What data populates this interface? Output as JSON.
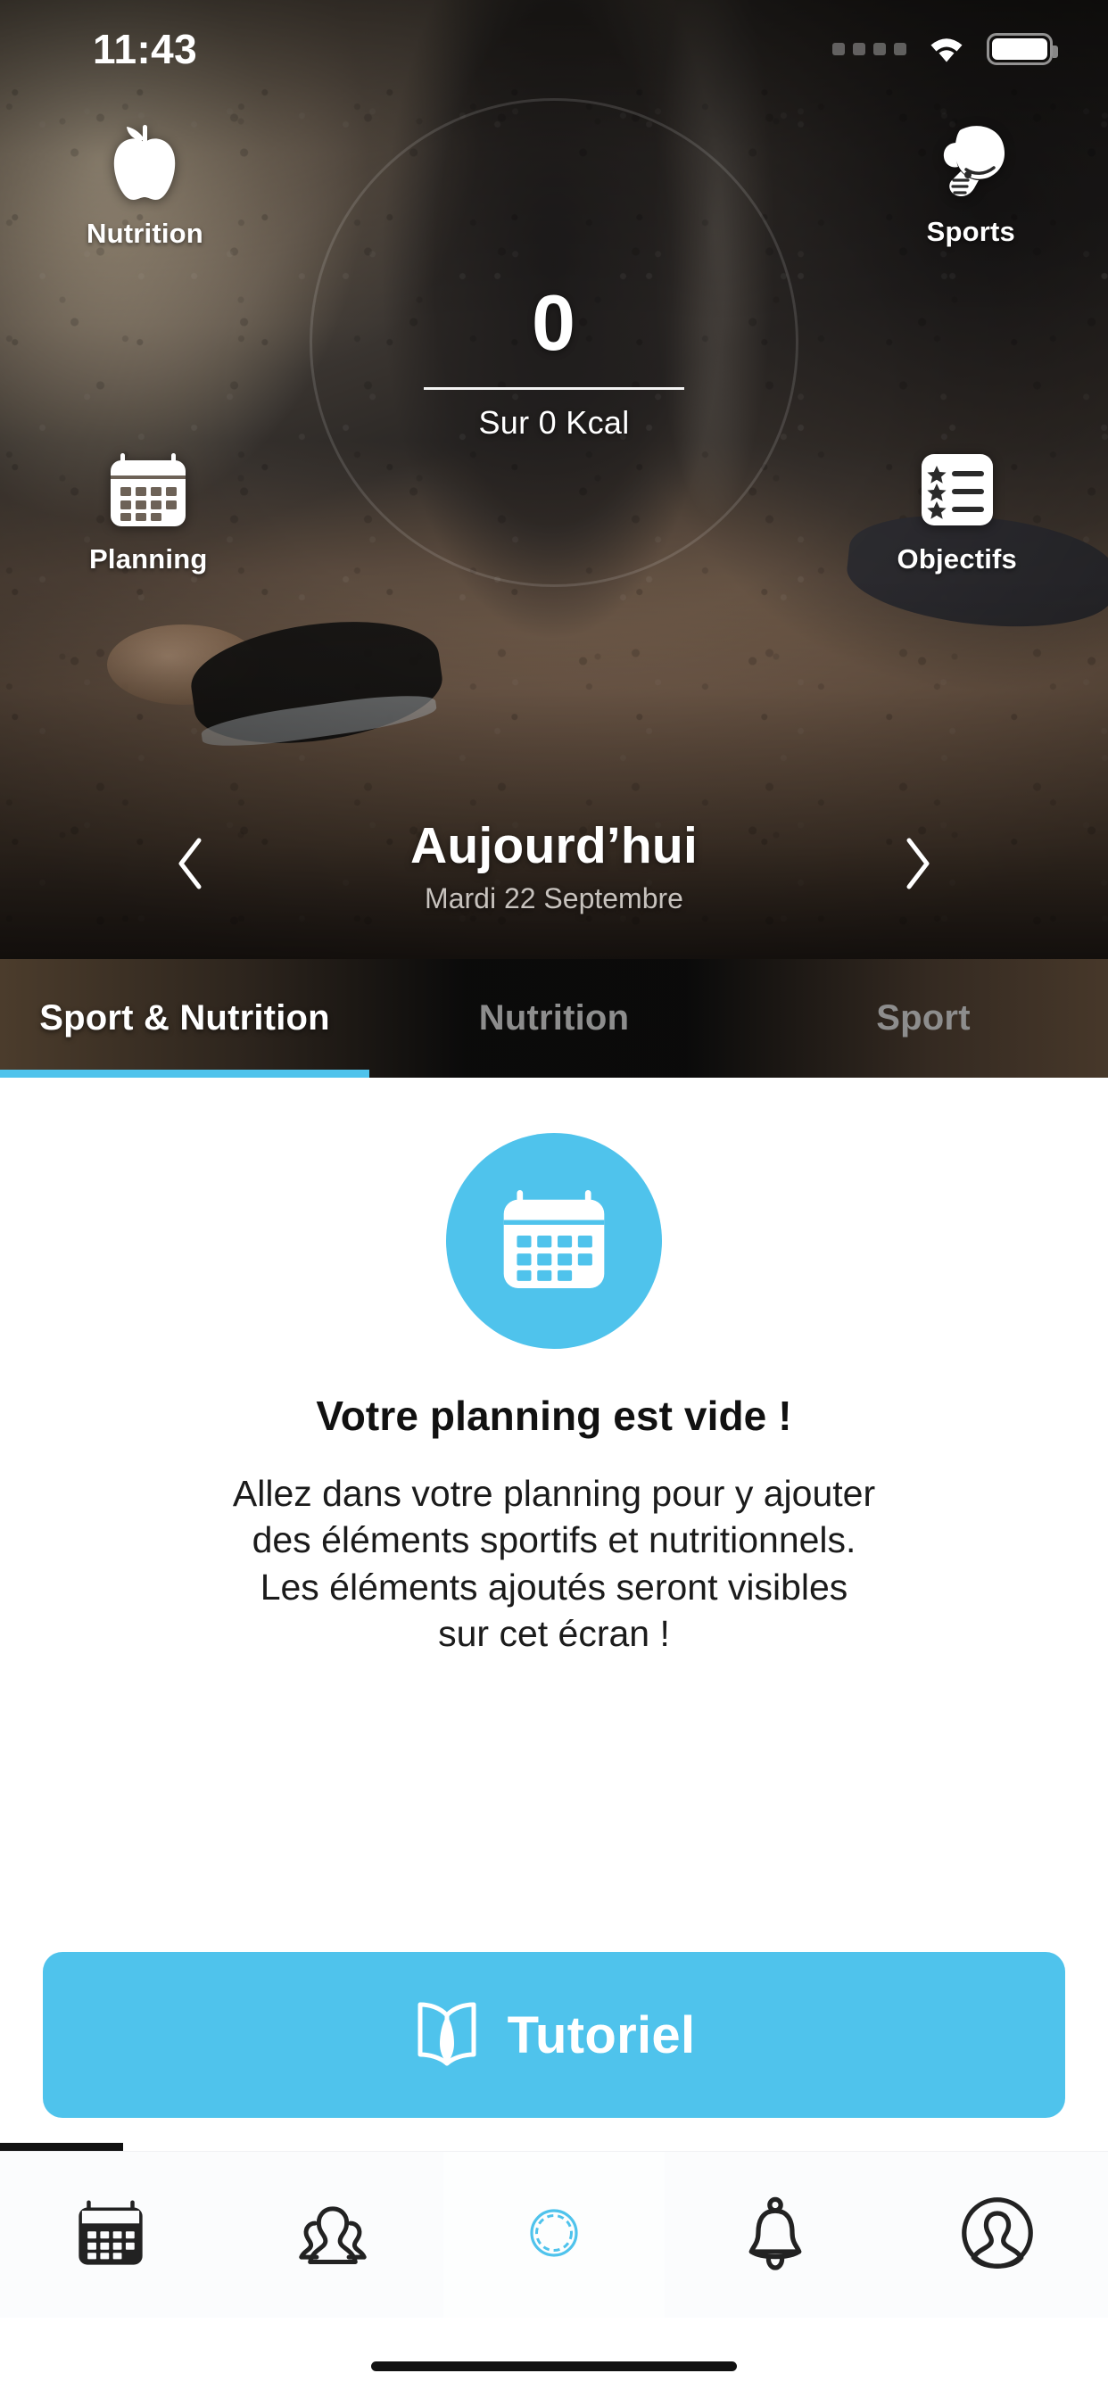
{
  "status_bar": {
    "time": "11:43",
    "signal_icon": "signal-dots-icon",
    "wifi_icon": "wifi-icon",
    "battery_icon": "battery-full-icon"
  },
  "hero": {
    "tiles": [
      {
        "id": "nutrition",
        "label": "Nutrition",
        "icon": "apple-icon"
      },
      {
        "id": "sports",
        "label": "Sports",
        "icon": "boxing-glove-icon"
      },
      {
        "id": "planning",
        "label": "Planning",
        "icon": "calendar-icon"
      },
      {
        "id": "objectifs",
        "label": "Objectifs",
        "icon": "star-list-icon"
      }
    ],
    "calorie": {
      "value": "0",
      "subtitle": "Sur 0 Kcal"
    },
    "date": {
      "title": "Aujourd’hui",
      "subtitle": "Mardi 22 Septembre",
      "prev_icon": "chevron-left-icon",
      "next_icon": "chevron-right-icon"
    }
  },
  "tabs": {
    "items": [
      {
        "label": "Sport & Nutrition",
        "active": true
      },
      {
        "label": "Nutrition",
        "active": false
      },
      {
        "label": "Sport",
        "active": false
      }
    ],
    "active_index": 0
  },
  "empty_state": {
    "icon": "calendar-icon",
    "title": "Votre planning est vide !",
    "body_line_1": "Allez dans votre planning pour y ajouter",
    "body_line_2": "des éléments sportifs et nutritionnels.",
    "body_line_3": "Les éléments ajoutés seront visibles",
    "body_line_4": "sur cet écran !"
  },
  "tutorial_button": {
    "label": "Tutoriel",
    "icon": "open-book-icon"
  },
  "bottom_nav": {
    "items": [
      {
        "id": "planning",
        "icon": "calendar-filled-icon",
        "active": true
      },
      {
        "id": "community",
        "icon": "people-group-icon",
        "active": false
      },
      {
        "id": "activity-ring",
        "icon": "ring-loader-icon",
        "active": false
      },
      {
        "id": "notifications",
        "icon": "bell-icon",
        "active": false
      },
      {
        "id": "profile",
        "icon": "user-circle-icon",
        "active": false
      }
    ]
  },
  "colors": {
    "accent": "#4FC3EC",
    "tab_bar_bg": "#151311",
    "tab_inactive_text": "#8D8D8D",
    "content_bg": "#FFFFFF",
    "nav_icon": "#222222"
  }
}
